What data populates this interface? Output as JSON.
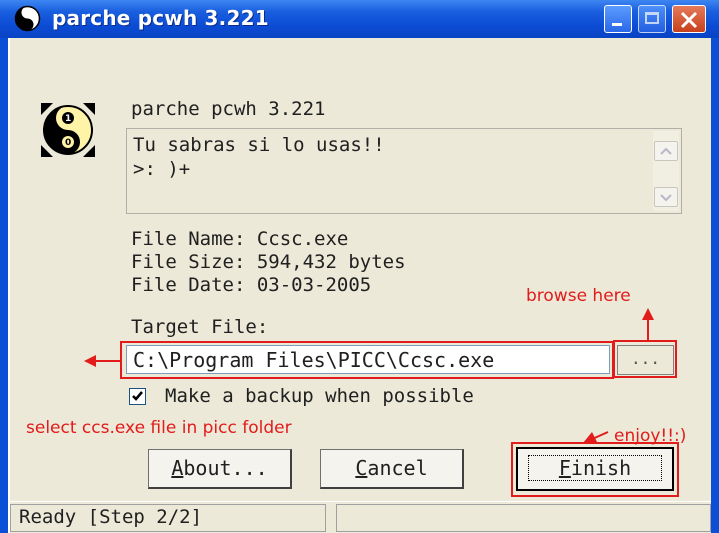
{
  "window": {
    "title": "parche pcwh 3.221",
    "controls": [
      "minimize-icon",
      "maximize-icon",
      "close-icon"
    ]
  },
  "header": {
    "app_name": "parche pcwh 3.221",
    "logo_icon": "yin-yang-icon"
  },
  "memo": {
    "line1": "Tu sabras si lo usas!!",
    "line2": ">: )+"
  },
  "file_info": {
    "name": "File Name: Ccsc.exe",
    "size": "File Size: 594,432 bytes",
    "date": "File Date: 03-03-2005"
  },
  "target": {
    "label": "Target File:",
    "value": "C:\\Program Files\\PICC\\Ccsc.exe",
    "browse_label": "..."
  },
  "backup": {
    "checked": true,
    "label": "Make a backup when possible"
  },
  "buttons": {
    "about": "About...",
    "about_mnemonic": "A",
    "about_rest": "bout...",
    "cancel_mnemonic": "C",
    "cancel_rest": "ancel",
    "finish_mnemonic": "F",
    "finish_rest": "inish"
  },
  "status": {
    "text": "Ready [Step 2/2]"
  },
  "annotations": {
    "browse_here": "browse here",
    "select_file": "select ccs.exe file in picc folder",
    "enjoy": "enjoy!!:)",
    "color": "#e21b1b"
  }
}
